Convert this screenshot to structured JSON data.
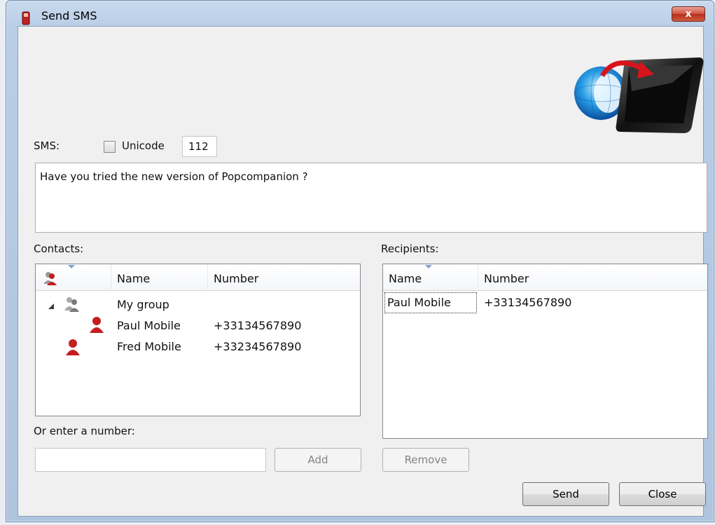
{
  "window": {
    "title": "Send SMS",
    "close_glyph": "x"
  },
  "sms": {
    "label": "SMS:",
    "unicode_label": "Unicode",
    "unicode_checked": false,
    "counter": "112",
    "message": "Have you tried the new version of Popcompanion ?"
  },
  "contacts": {
    "label": "Contacts:",
    "columns": [
      "Name",
      "Number"
    ],
    "group": {
      "name": "My group"
    },
    "rows": [
      {
        "name": "Paul Mobile",
        "number": "+33134567890"
      },
      {
        "name": "Fred Mobile",
        "number": "+33234567890"
      }
    ]
  },
  "recipients": {
    "label": "Recipients:",
    "columns": [
      "Name",
      "Number"
    ],
    "rows": [
      {
        "name": "Paul Mobile",
        "number": "+33134567890"
      }
    ]
  },
  "manual": {
    "label": "Or enter a number:",
    "value": ""
  },
  "buttons": {
    "add": "Add",
    "remove": "Remove",
    "send": "Send",
    "close": "Close"
  },
  "icons": {
    "title": "phone-icon",
    "header": "globe-to-phone-icon",
    "contact": "person-icon",
    "group": "group-icon",
    "expand": "expanded-triangle-icon"
  },
  "colors": {
    "contact_red": "#c41f1f",
    "group_gray": "#8a8a8a",
    "accent_blue": "#7da2ce"
  }
}
